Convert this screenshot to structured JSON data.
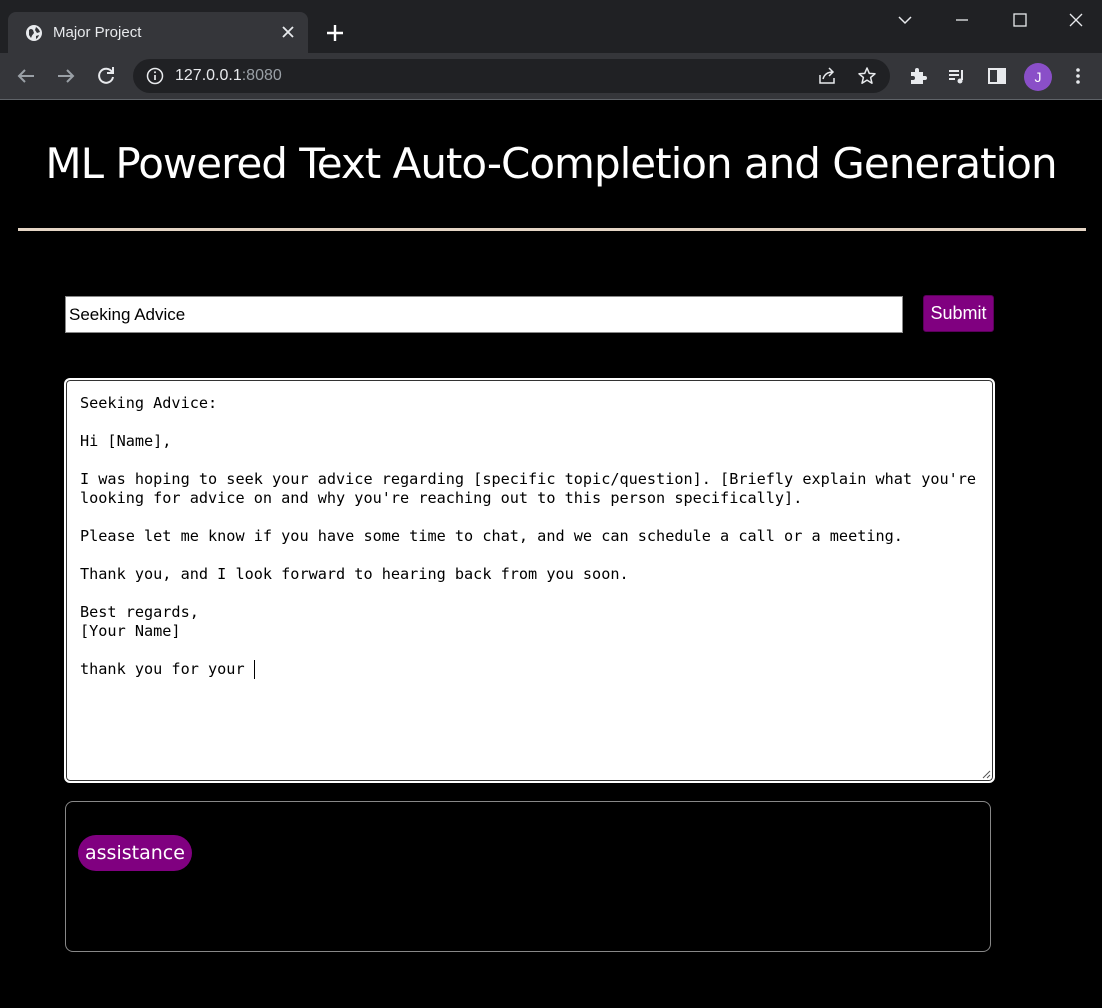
{
  "browser": {
    "tab_title": "Major Project",
    "url_host": "127.0.0.1",
    "url_port": ":8080",
    "profile_initial": "J"
  },
  "page": {
    "title": "ML Powered Text Auto-Completion and Generation",
    "topic_input_value": "Seeking Advice",
    "submit_label": "Submit",
    "editor_text": "Seeking Advice:\n\nHi [Name],\n\nI was hoping to seek your advice regarding [specific topic/question]. [Briefly explain what you're looking for advice on and why you're reaching out to this person specifically].\n\nPlease let me know if you have some time to chat, and we can schedule a call or a meeting.\n\nThank you, and I look forward to hearing back from you soon.\n\nBest regards,\n[Your Name]\n\nthank you for your ",
    "suggestions": [
      "assistance"
    ]
  },
  "colors": {
    "accent": "#800080",
    "background": "#000000",
    "divider": "#e5d5c5"
  }
}
